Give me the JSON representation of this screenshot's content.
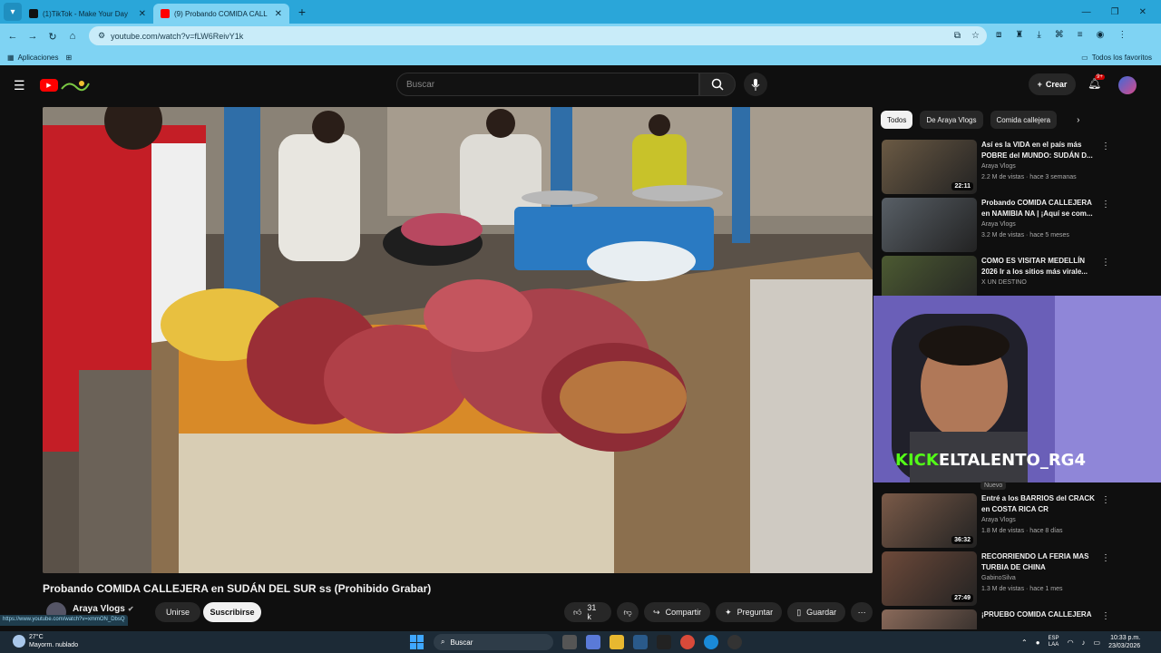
{
  "browser": {
    "tabs": [
      {
        "title": "(1)TikTok - Make Your Day",
        "active": false
      },
      {
        "title": "(9) Probando COMIDA CALL",
        "active": true
      }
    ],
    "url": "youtube.com/watch?v=fLW6ReivY1k",
    "bookmarks": {
      "apps_label": "Aplicaciones",
      "all_favorites": "Todos los favoritos"
    }
  },
  "youtube": {
    "search_placeholder": "Buscar",
    "create_label": "Crear",
    "notif_badge": "9+",
    "video": {
      "title": "Probando COMIDA CALLEJERA en SUDÁN DEL SUR ss (Prohibido Grabar)",
      "channel": "Araya Vlogs",
      "join_label": "Unirse",
      "subscribe_label": "Suscribirse",
      "likes": "31 k",
      "share_label": "Compartir",
      "ask_label": "Preguntar",
      "save_label": "Guardar"
    },
    "status_url": "https://www.youtube.com/watch?v=xmmON_DbsQ",
    "chips": [
      "Todos",
      "De Araya Vlogs",
      "Comida callejera"
    ],
    "recommendations": [
      {
        "title": "Así es la VIDA en el país más POBRE del MUNDO: SUDÁN D...",
        "channel": "Araya Vlogs",
        "meta": "2.2 M de vistas · hace 3 semanas",
        "duration": "22:11",
        "color": "#6b5a44"
      },
      {
        "title": "Probando COMIDA CALLEJERA en NAMIBIA NA | ¡Aquí se com...",
        "channel": "Araya Vlogs",
        "meta": "3.2 M de vistas · hace 5 meses",
        "duration": "",
        "color": "#585f66"
      },
      {
        "title": "COMO ES VISITAR MEDELLÍN 2026 Ir a los sitios más virale...",
        "channel": "X UN DESTINO",
        "meta": "",
        "duration": "",
        "color": "#4c5a32"
      },
      {
        "title": "Entré a los BARRIOS del CRACK en COSTA RICA CR",
        "channel": "Araya Vlogs",
        "meta": "1.8 M de vistas · hace 8 días",
        "duration": "36:32",
        "color": "#7a5a48"
      },
      {
        "title": "RECORRIENDO LA FERIA MAS TURBIA DE CHINA",
        "channel": "GabinoSilva",
        "meta": "1.3 M de vistas · hace 1 mes",
        "duration": "27:49",
        "color": "#6e4a3a"
      },
      {
        "title": "¡PRUEBO COMIDA CALLEJERA",
        "channel": "",
        "meta": "",
        "duration": "",
        "color": "#8a6a5a"
      }
    ],
    "nuevo_label": "Nuevo",
    "overlay": {
      "kick": "KICK",
      "handle": "ELTALENTO_RG4"
    }
  },
  "taskbar": {
    "temp": "27°C",
    "weather": "Mayorm. nublado",
    "search": "Buscar",
    "lang1": "ESP",
    "lang2": "LAA",
    "time": "10:33 p.m.",
    "date": "23/03/2026"
  }
}
